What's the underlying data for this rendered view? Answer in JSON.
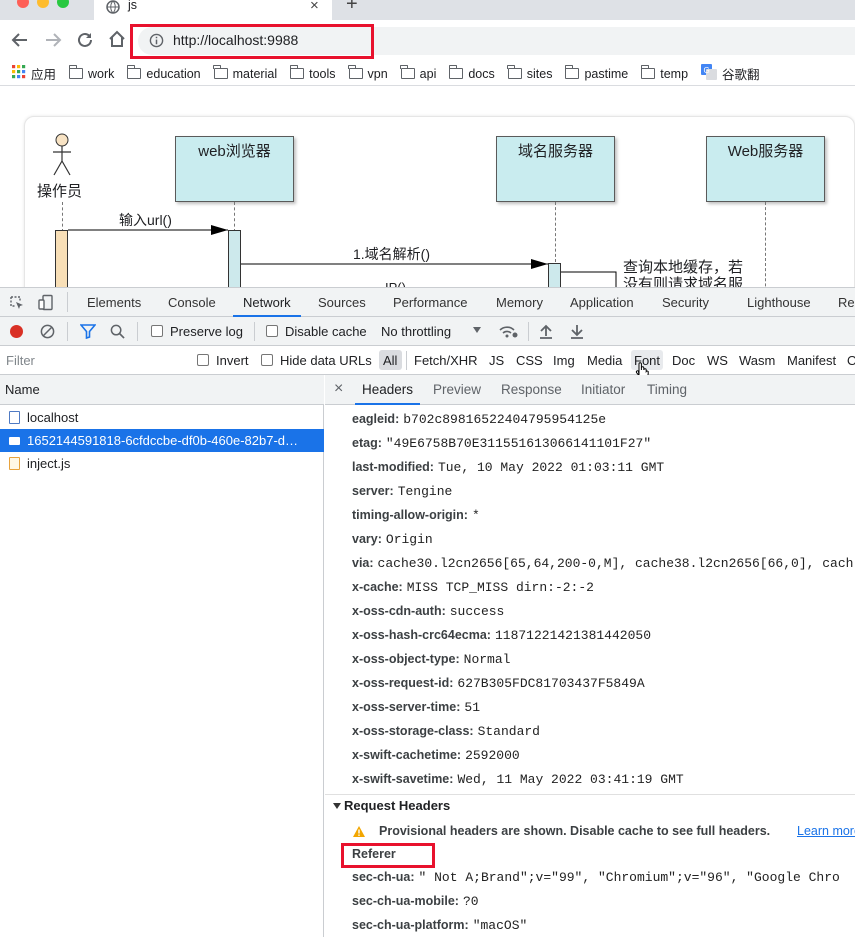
{
  "browser": {
    "tab_title": "js",
    "new_tab_symbol": "+",
    "close_symbol": "×",
    "url": "http://localhost:9988"
  },
  "bookmarks": [
    {
      "label": "应用",
      "icon": "apps-grid-icon"
    },
    {
      "label": "work",
      "icon": "folder-icon"
    },
    {
      "label": "education",
      "icon": "folder-icon"
    },
    {
      "label": "material",
      "icon": "folder-icon"
    },
    {
      "label": "tools",
      "icon": "folder-icon"
    },
    {
      "label": "vpn",
      "icon": "folder-icon"
    },
    {
      "label": "api",
      "icon": "folder-icon"
    },
    {
      "label": "docs",
      "icon": "folder-icon"
    },
    {
      "label": "sites",
      "icon": "folder-icon"
    },
    {
      "label": "pastime",
      "icon": "folder-icon"
    },
    {
      "label": "temp",
      "icon": "folder-icon"
    },
    {
      "label": "谷歌翻",
      "icon": "google-translate-icon"
    }
  ],
  "diagram": {
    "actor": "操作员",
    "lifelines": [
      "web浏览器",
      "域名服务器",
      "Web服务器"
    ],
    "msg1": "输入url()",
    "msg2": "1.域名解析()",
    "msg3": "IP()",
    "note_line1": "查询本地缓存，若",
    "note_line2": "没有则请求域名服"
  },
  "devtools": {
    "tabs": [
      "Elements",
      "Console",
      "Network",
      "Sources",
      "Performance",
      "Memory",
      "Application",
      "Security",
      "Lighthouse",
      "Re"
    ],
    "active_tab": "Network",
    "preserve_log": "Preserve log",
    "disable_cache": "Disable cache",
    "throttling": "No throttling",
    "filter_placeholder": "Filter",
    "invert": "Invert",
    "hide_data_urls": "Hide data URLs",
    "type_filters": [
      "All",
      "Fetch/XHR",
      "JS",
      "CSS",
      "Img",
      "Media",
      "Font",
      "Doc",
      "WS",
      "Wasm",
      "Manifest",
      "O"
    ],
    "name_header": "Name",
    "requests": [
      {
        "name": "localhost",
        "selected": false,
        "icon": "document-icon"
      },
      {
        "name": "1652144591818-6cfdccbe-df0b-460e-82b7-d…",
        "selected": true,
        "icon": "image-icon"
      },
      {
        "name": "inject.js",
        "selected": false,
        "icon": "script-icon"
      }
    ],
    "detail_tabs": [
      "Headers",
      "Preview",
      "Response",
      "Initiator",
      "Timing"
    ],
    "active_detail_tab": "Headers",
    "response_headers": [
      {
        "k": "eagleid:",
        "v": "b702c89816522404795954125e"
      },
      {
        "k": "etag:",
        "v": "\"49E6758B70E311551613066141101F27\""
      },
      {
        "k": "last-modified:",
        "v": "Tue, 10 May 2022 01:03:11 GMT"
      },
      {
        "k": "server:",
        "v": "Tengine"
      },
      {
        "k": "timing-allow-origin:",
        "v": "*"
      },
      {
        "k": "vary:",
        "v": "Origin"
      },
      {
        "k": "via:",
        "v": "cache30.l2cn2656[65,64,200-0,M], cache38.l2cn2656[66,0], cach"
      },
      {
        "k": "x-cache:",
        "v": "MISS TCP_MISS dirn:-2:-2"
      },
      {
        "k": "x-oss-cdn-auth:",
        "v": "success"
      },
      {
        "k": "x-oss-hash-crc64ecma:",
        "v": "11871221421381442050"
      },
      {
        "k": "x-oss-object-type:",
        "v": "Normal"
      },
      {
        "k": "x-oss-request-id:",
        "v": "627B305FDC81703437F5849A"
      },
      {
        "k": "x-oss-server-time:",
        "v": "51"
      },
      {
        "k": "x-oss-storage-class:",
        "v": "Standard"
      },
      {
        "k": "x-swift-cachetime:",
        "v": "2592000"
      },
      {
        "k": "x-swift-savetime:",
        "v": "Wed, 11 May 2022 03:41:19 GMT"
      }
    ],
    "request_headers_title": "Request Headers",
    "provisional_warning": "Provisional headers are shown. Disable cache to see full headers.",
    "learn_more": "Learn more",
    "referer": "Referer",
    "request_headers": [
      {
        "k": "sec-ch-ua:",
        "v": "\" Not A;Brand\";v=\"99\", \"Chromium\";v=\"96\", \"Google Chro"
      },
      {
        "k": "sec-ch-ua-mobile:",
        "v": "?0"
      },
      {
        "k": "sec-ch-ua-platform:",
        "v": "\"macOS\""
      }
    ]
  },
  "colors": {
    "accent": "#1a73e8",
    "highlight": "#e8112d",
    "lifeline_fill": "#c9ecef"
  }
}
